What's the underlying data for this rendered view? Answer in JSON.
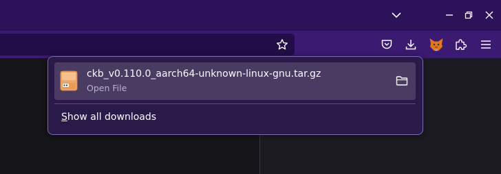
{
  "window": {
    "controls": [
      "list-all-tabs-icon",
      "minimize-icon",
      "restore-icon",
      "close-icon"
    ]
  },
  "toolbar": {
    "icons": [
      "star-icon",
      "pocket-icon",
      "download-icon",
      "fox-extension-icon",
      "puzzle-icon",
      "hamburger-menu-icon"
    ]
  },
  "downloads_panel": {
    "items": [
      {
        "file_name": "ckb_v0.110.0_aarch64-unknown-linux-gnu.tar.gz",
        "status": "Open File",
        "icon": "archive-file-icon"
      }
    ],
    "show_all_label": "Show all downloads"
  },
  "colors": {
    "titlebar": "#2b1259",
    "toolbar": "#3b1a72",
    "panel_bg": "#2a1a4a",
    "item_bg": "#4a3b63"
  }
}
